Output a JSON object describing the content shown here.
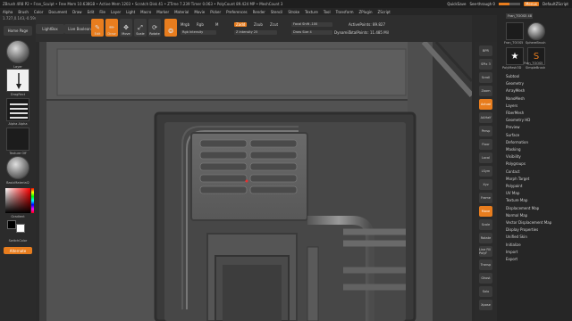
{
  "titlebar": {
    "title": "ZBrush 4R8 P2 • Fran_Sculpt • Free Mem 10.638GB • Active Mem 1203 • Scratch Disk 41 • ZTime 7.239 Timer 0.063 • PolyCount 89.424 MP • MeshCount 3",
    "quicksave": "QuickSave",
    "seethrough": "See-through 0",
    "menus": "Menus",
    "defaultscript": "DefaultZScript"
  },
  "menubar": {
    "items": [
      "Alpha",
      "Brush",
      "Color",
      "Document",
      "Draw",
      "Edit",
      "File",
      "Layer",
      "Light",
      "Macro",
      "Marker",
      "Material",
      "Movie",
      "Picker",
      "Preferences",
      "Render",
      "Stencil",
      "Stroke",
      "Texture",
      "Tool",
      "Transform",
      "ZPlugin",
      "ZScript"
    ]
  },
  "coord": "1.727,0.143,-0.594",
  "leftshelf": {
    "homepage": "Home Page",
    "lightbox": "LightBox",
    "liveboolean": "Live Boolean",
    "brush_label": "Layer",
    "stroke_label": "DragRect",
    "alpha_label": "Alpha Alpha",
    "texture_label": "Texture Off",
    "material_label": "BasicMaterial2",
    "gradient_label": "Gradient",
    "switchcolor": "SwitchColor",
    "alternate": "Alternate"
  },
  "toolbar": {
    "edit": "Edit",
    "draw": "Draw",
    "move": "Move",
    "scale": "Scale",
    "rotate": "Rotate",
    "mrgb": "Mrgb",
    "rgb": "Rgb",
    "m": "M",
    "rgb_intensity": "Rgb Intensity",
    "zadd": "Zadd",
    "zsub": "Zsub",
    "zcut": "Zcut",
    "z_intensity": "Z Intensity 25",
    "focal_shift": "Focal Shift -100",
    "draw_size": "Draw Size 4",
    "dynamic": "Dynamic",
    "active_points": "ActivePoints: 89.827",
    "total_points": "TotalPoints: 11.485 Mil"
  },
  "rtools": [
    "BPR",
    "SPix 3",
    "Scroll",
    "Zoom",
    "Actual",
    "AAHalf",
    "Persp",
    "Floor",
    "Local",
    "LSym",
    "Xyz",
    "Frame",
    "Move",
    "Scale",
    "Rotate",
    "Line Fill PolyF",
    "Transp",
    "Ghost",
    "Solo",
    "Xpose"
  ],
  "rpanel": {
    "tool_name": "Fran_TOOS5 48",
    "thumbs": [
      "Fran_TOOS5",
      "SphereBrush",
      "SimpleBrush",
      "PolyMesh3D",
      "Fran_TOOS5"
    ],
    "subtools": [
      "Subtool",
      "Geometry",
      "ArrayMesh",
      "NanoMesh",
      "Layers",
      "FiberMesh",
      "Geometry HD",
      "Preview",
      "Surface",
      "Deformation",
      "Masking",
      "Visibility",
      "Polygroups",
      "Contact",
      "Morph Target",
      "Polypaint",
      "UV Map",
      "Texture Map",
      "Displacement Map",
      "Normal Map",
      "Vector Displacement Map",
      "Display Properties",
      "Unified Skin",
      "Initialize",
      "Import",
      "Export"
    ]
  },
  "colors": {
    "accent": "#e87d1e",
    "active_color": "#e83030"
  }
}
